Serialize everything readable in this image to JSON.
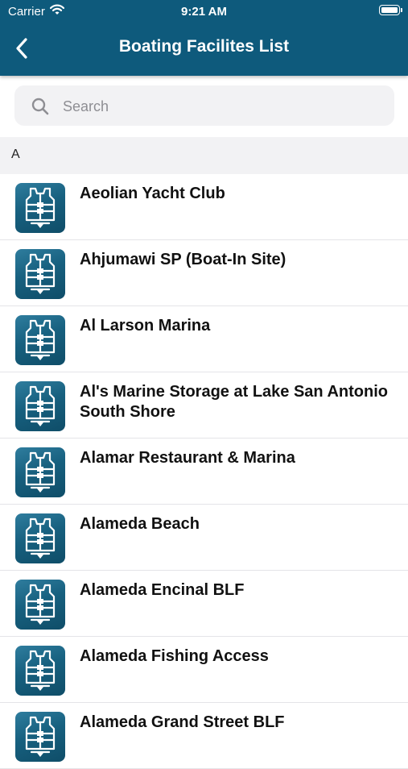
{
  "status_bar": {
    "carrier": "Carrier",
    "time": "9:21 AM"
  },
  "nav": {
    "title": "Boating Facilites List",
    "back_icon": "chevron-left-icon"
  },
  "search": {
    "placeholder": "Search",
    "value": "",
    "icon": "search-icon"
  },
  "section": {
    "letter": "A"
  },
  "colors": {
    "header": "#0e5a7c",
    "icon_tile": "#17607f",
    "section_bg": "#f2f2f4"
  },
  "facilities": [
    {
      "name": "Aeolian Yacht Club"
    },
    {
      "name": "Ahjumawi SP (Boat-In Site)"
    },
    {
      "name": "Al Larson Marina"
    },
    {
      "name": "Al's Marine Storage at Lake San Antonio South Shore"
    },
    {
      "name": "Alamar Restaurant & Marina"
    },
    {
      "name": "Alameda Beach"
    },
    {
      "name": "Alameda Encinal BLF"
    },
    {
      "name": "Alameda Fishing Access"
    },
    {
      "name": "Alameda Grand Street BLF"
    }
  ]
}
